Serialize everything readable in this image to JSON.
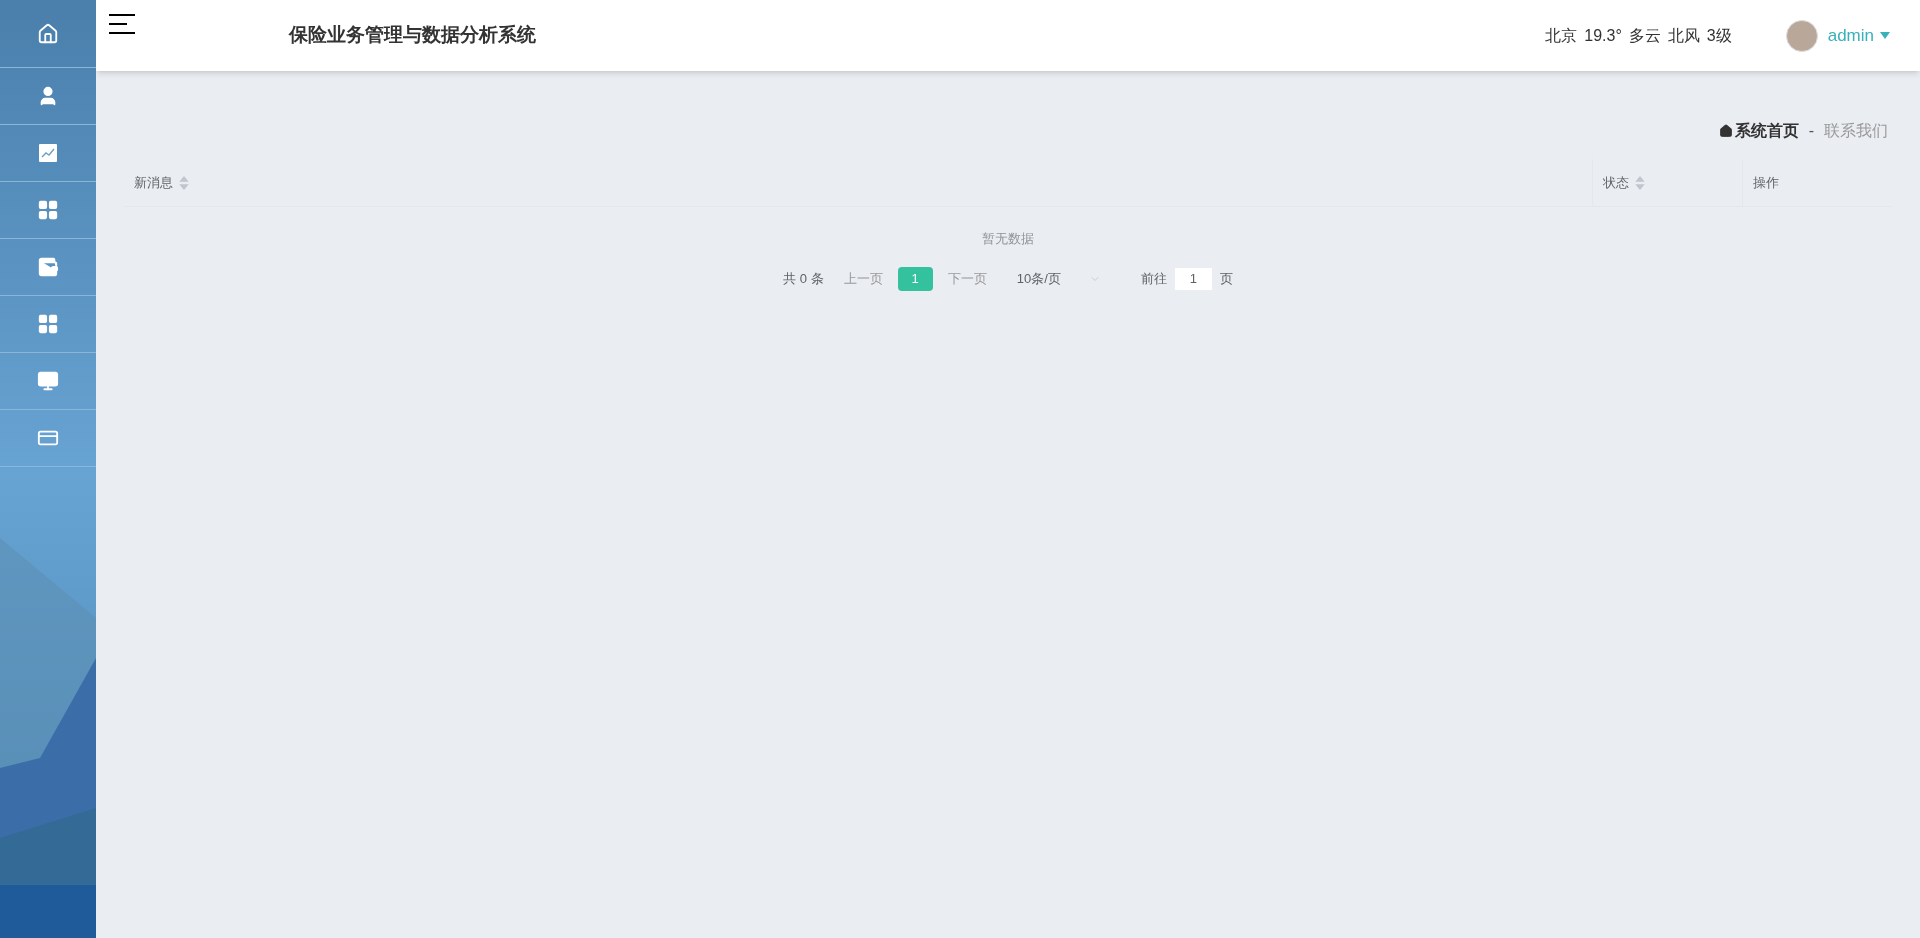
{
  "header": {
    "title": "保险业务管理与数据分析系统",
    "weather": [
      "北京",
      "19.3°",
      "多云",
      "北风",
      "3级"
    ],
    "user": "admin"
  },
  "breadcrumb": {
    "items": [
      "系统首页",
      "联系我们"
    ],
    "separator": "-"
  },
  "table": {
    "columns": [
      {
        "label": "新消息",
        "sortable": true
      },
      {
        "label": "状态",
        "sortable": true
      },
      {
        "label": "操作",
        "sortable": false
      }
    ],
    "empty_text": "暂无数据",
    "pagination": {
      "total": "共 0 条",
      "prev": {
        "label": "上一页",
        "disabled": true
      },
      "pages": [
        {
          "label": "1",
          "selected": true
        }
      ],
      "next": {
        "label": "下一页",
        "disabled": true
      },
      "page_size": "10条/页",
      "goto_label": "前往",
      "goto_value": "1",
      "goto_suffix": "页"
    }
  }
}
